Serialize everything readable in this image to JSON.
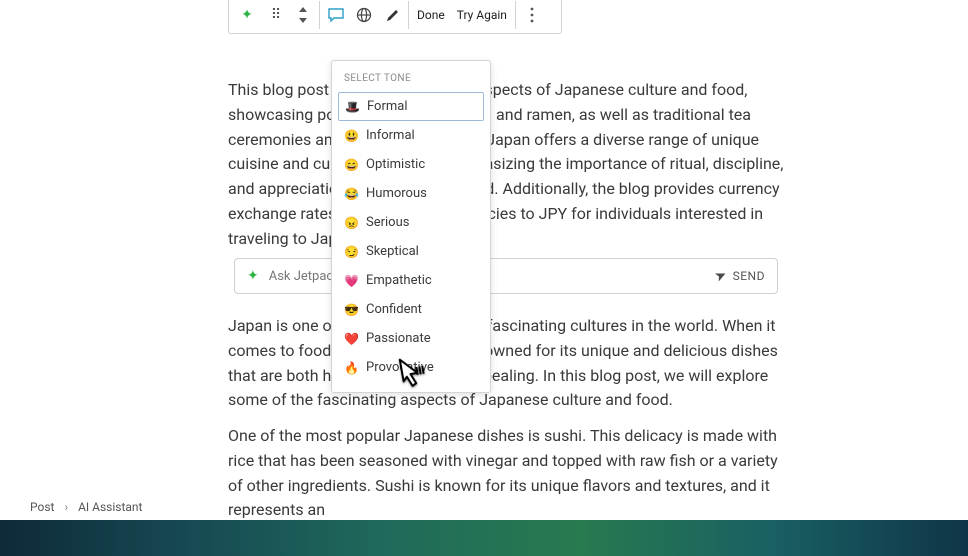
{
  "toolbar": {
    "done_label": "Done",
    "try_again_label": "Try Again"
  },
  "paragraphs": {
    "intro": "This blog post explores the unique aspects of Japanese culture and food, showcasing popular dishes like sushi and ramen, as well as traditional tea ceremonies and etiquette practices. Japan offers a diverse range of unique cuisine and cultural traditions, emphasizing the importance of ritual, discipline, and appreciation for the natural world. Additionally, the blog provides currency exchange rates from different currencies to JPY for individuals interested in traveling to Japan.",
    "body1": "Japan is one of the oldest and most fascinating cultures in the world. When it comes to food, Japan is globally renowned for its unique and delicious dishes that are both healthy and visually appealing. In this blog post, we will explore some of the fascinating aspects of Japanese culture and food.",
    "body2": "One of the most popular Japanese dishes is sushi. This delicacy is made with rice that has been seasoned with vinegar and topped with raw fish or a variety of other ingredients. Sushi is known for its unique flavors and textures, and it represents an"
  },
  "ask": {
    "placeholder": "Ask Jetpack AI",
    "send_label": "SEND"
  },
  "tone_panel": {
    "title": "SELECT TONE",
    "items": [
      {
        "icon": "🎩",
        "label": "Formal"
      },
      {
        "icon": "😃",
        "label": "Informal"
      },
      {
        "icon": "😄",
        "label": "Optimistic"
      },
      {
        "icon": "😂",
        "label": "Humorous"
      },
      {
        "icon": "😠",
        "label": "Serious"
      },
      {
        "icon": "😏",
        "label": "Skeptical"
      },
      {
        "icon": "💗",
        "label": "Empathetic"
      },
      {
        "icon": "😎",
        "label": "Confident"
      },
      {
        "icon": "❤️",
        "label": "Passionate"
      },
      {
        "icon": "🔥",
        "label": "Provocative"
      }
    ]
  },
  "breadcrumb": {
    "root": "Post",
    "current": "AI Assistant"
  }
}
